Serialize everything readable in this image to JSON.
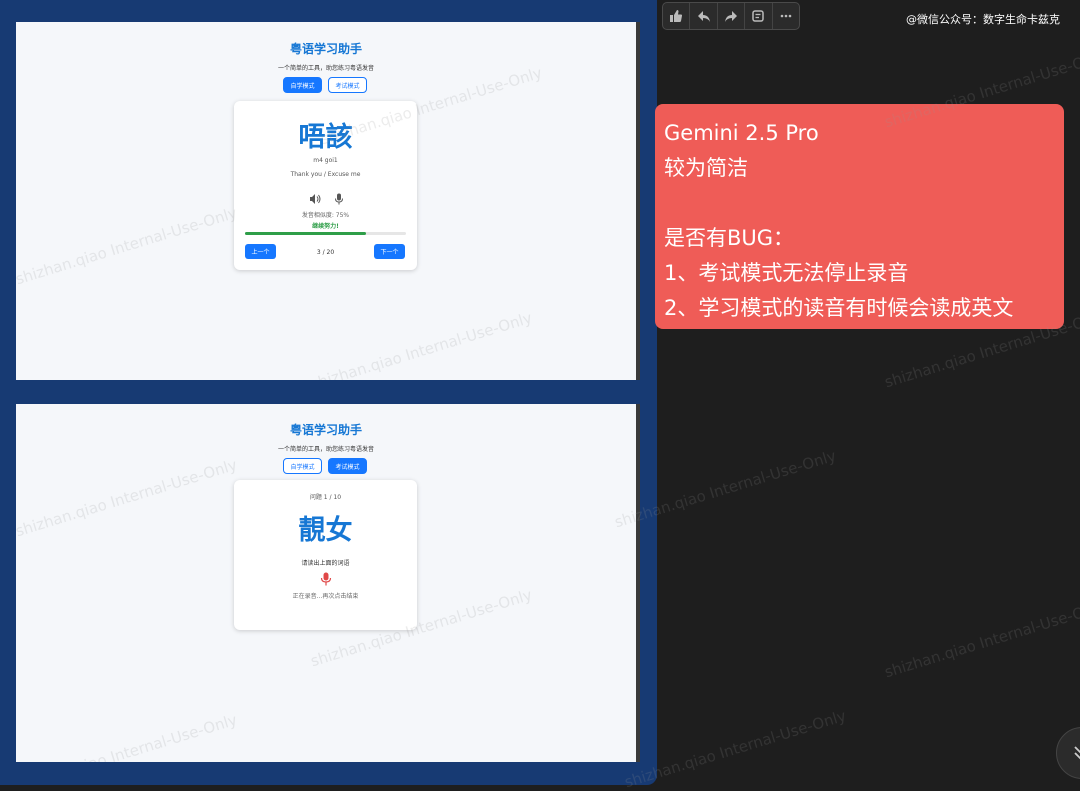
{
  "colors": {
    "primary": "#1677ff",
    "title_blue": "#1677d4",
    "success_green": "#2e9e48",
    "mic_red": "#e04848",
    "note_bg": "#ef5c57",
    "frame_blue": "#173a73"
  },
  "toolbar": {
    "icons": [
      "thumbs-up-icon",
      "reply-icon",
      "forward-icon",
      "quote-icon",
      "more-icon"
    ]
  },
  "credit": "@微信公众号：数字生命卡兹克",
  "screen1": {
    "title": "粤语学习助手",
    "subtitle": "一个简单的工具，助您练习粤语发音",
    "mode_self": "自学模式",
    "mode_exam": "考试模式",
    "word": "唔該",
    "jyutping": "m4 goi1",
    "meaning": "Thank you / Excuse me",
    "similarity": "发音相似度: 75%",
    "progress": 0.75,
    "feedback": "继续努力!",
    "prev": "上一个",
    "counter": "3 / 20",
    "next": "下一个"
  },
  "screen2": {
    "title": "粤语学习助手",
    "subtitle": "一个简单的工具，助您练习粤语发音",
    "mode_self": "自学模式",
    "mode_exam": "考试模式",
    "question": "问题 1 / 10",
    "word": "靚女",
    "instruction": "请读出上面的词语",
    "recording": "正在录音...再次点击结束"
  },
  "note": {
    "lines": [
      "Gemini 2.5 Pro",
      "较为简洁",
      "",
      "是否有BUG：",
      "1、考试模式无法停止录音",
      "2、学习模式的读音有时候会读成英文"
    ]
  },
  "watermark": "shizhan.qiao Internal-Use-Only"
}
